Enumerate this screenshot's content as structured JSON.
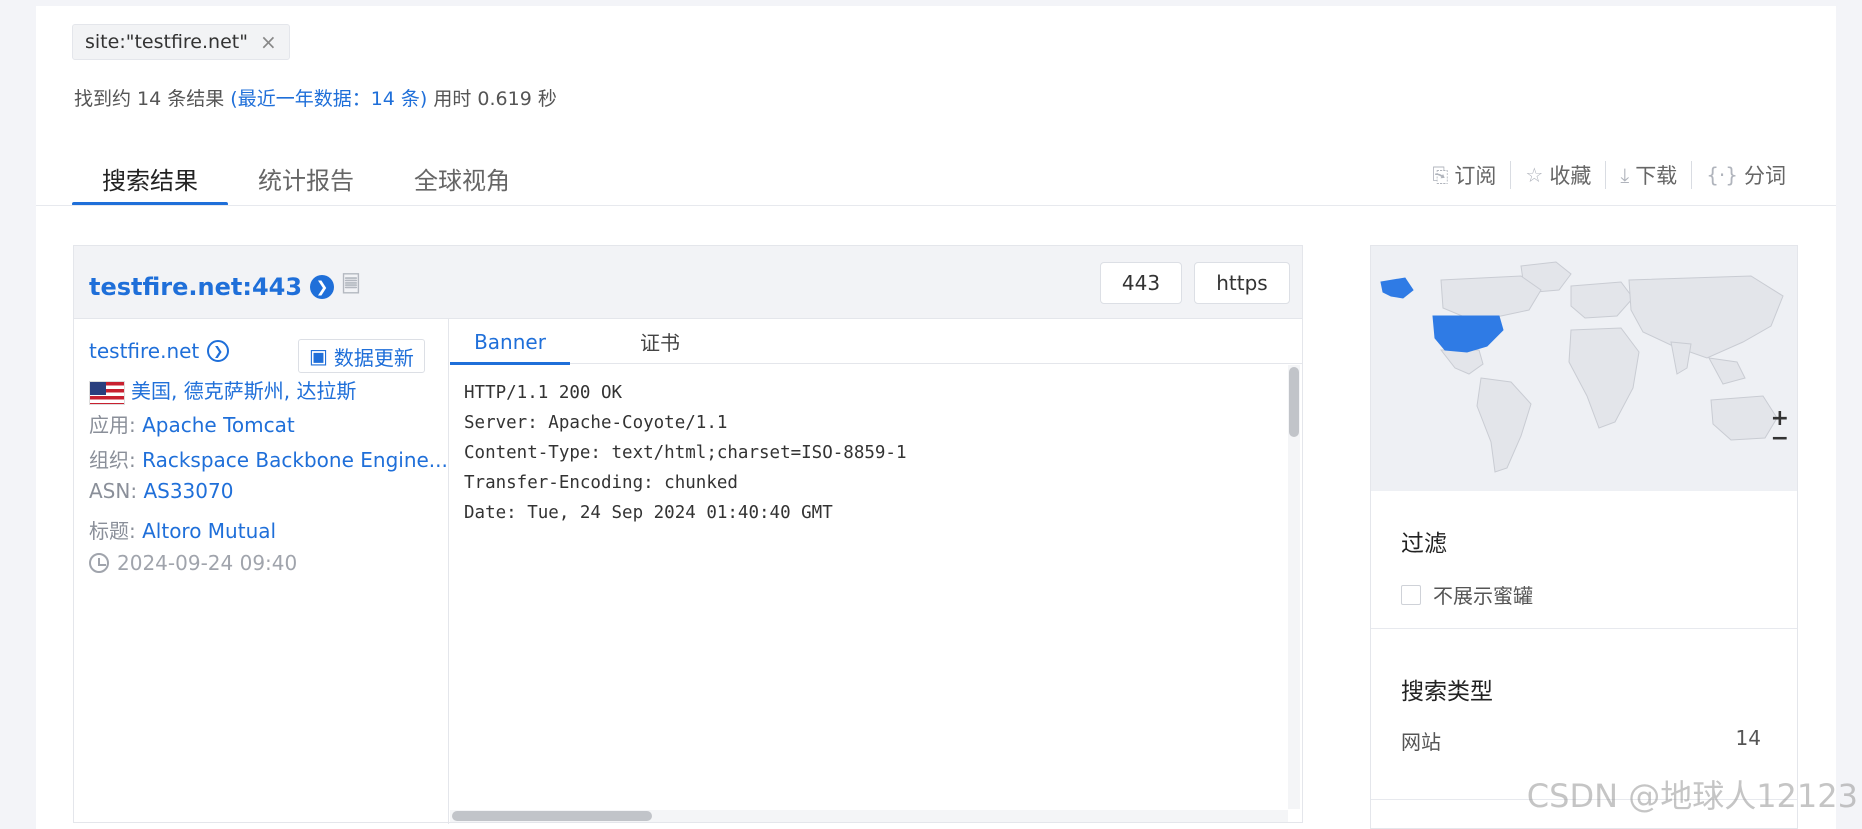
{
  "search": {
    "query_tag": "site:\"testfire.net\"",
    "close_icon": "×",
    "summary_prefix": "找到约 14 条结果 ",
    "summary_recent": "(最近一年数据：14 条)",
    "summary_time": " 用时 0.619 秒"
  },
  "tabs": [
    {
      "label": "搜索结果",
      "active": true
    },
    {
      "label": "统计报告",
      "active": false
    },
    {
      "label": "全球视角",
      "active": false
    }
  ],
  "actions": [
    {
      "label": "订阅",
      "icon": "subscribe-icon",
      "glyph": "⎘"
    },
    {
      "label": "收藏",
      "icon": "star-icon",
      "glyph": "☆"
    },
    {
      "label": "下载",
      "icon": "download-icon",
      "glyph": "⤓"
    },
    {
      "label": "分词",
      "icon": "tokenize-icon",
      "glyph": "{·}"
    }
  ],
  "result": {
    "host": "testfire.net:443",
    "port": "443",
    "protocol": "https",
    "site": "testfire.net",
    "update_label": "数据更新",
    "location": [
      "美国",
      "德克萨斯州",
      "达拉斯"
    ],
    "app_label": "应用:",
    "app_value": "Apache Tomcat",
    "org_label": "组织:",
    "org_value": "Rackspace Backbone Engine...",
    "asn_label": "ASN:",
    "asn_value": "AS33070",
    "title_label": "标题:",
    "title_value": "Altoro Mutual",
    "time": "2024-09-24 09:40",
    "sub_tabs": [
      {
        "label": "Banner",
        "active": true
      },
      {
        "label": "证书",
        "active": false
      }
    ],
    "banner": "HTTP/1.1 200 OK\nServer: Apache-Coyote/1.1\nContent-Type: text/html;charset=ISO-8859-1\nTransfer-Encoding: chunked\nDate: Tue, 24 Sep 2024 01:40:40 GMT"
  },
  "sidebar": {
    "zoom_in": "+",
    "zoom_out": "−",
    "filter_title": "过滤",
    "filter_option": "不展示蜜罐",
    "type_title": "搜索类型",
    "type_name": "网站",
    "type_count": "14"
  },
  "watermark": "CSDN @地球人12123",
  "colors": {
    "accent": "#1f6fd9",
    "map_highlight": "#2f7be5",
    "map_land": "#e3e5ea"
  }
}
